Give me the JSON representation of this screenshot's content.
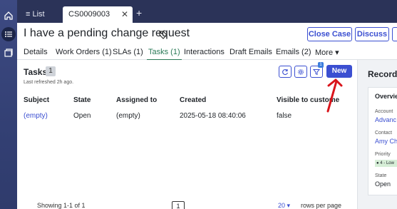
{
  "nav": {
    "icons": [
      "home-icon",
      "menu-list-icon",
      "records-icon"
    ]
  },
  "tabs": [
    {
      "label": "List",
      "icon": "list-icon"
    },
    {
      "label": "CS0009003",
      "close": "✕"
    }
  ],
  "new_tab_glyph": "+",
  "record": {
    "title": "I have a pending change request",
    "actions": [
      "Close Case",
      "Discuss"
    ]
  },
  "subtabs": [
    "Details",
    "Work Orders (1)",
    "SLAs (1)",
    "Tasks (1)",
    "Interactions",
    "Draft Emails",
    "Emails (2)",
    "More ▾"
  ],
  "active_subtab": "Tasks (1)",
  "tasks": {
    "title": "Tasks",
    "count": "1",
    "last_refreshed": "Last refreshed 2h ago.",
    "filter_badge": "1",
    "new_label": "New",
    "columns": [
      "Subject",
      "State",
      "Assigned to",
      "Created",
      "Visible to custome"
    ],
    "rows": [
      {
        "subject": "(empty)",
        "state": "Open",
        "assigned_to": "(empty)",
        "created": "2025-05-18 08:40:06",
        "visible": "false"
      }
    ],
    "footer": {
      "showing": "Showing 1-1 of 1",
      "page": "1",
      "rows_per_page_value": "20 ▾",
      "rows_per_page_label": "rows per page"
    }
  },
  "record_info": {
    "title": "Record I",
    "section": "Overvie",
    "fields": [
      {
        "label": "Account",
        "value": "Advanc"
      },
      {
        "label": "Contact",
        "value": "Amy Ch"
      },
      {
        "label": "Priority",
        "value": "4 - Low"
      },
      {
        "label": "State",
        "value": "Open"
      }
    ]
  },
  "colors": {
    "accent": "#3b4fd1",
    "rail": "#334074",
    "active_tab": "#2a7a57",
    "annotation": "#d9141b"
  }
}
